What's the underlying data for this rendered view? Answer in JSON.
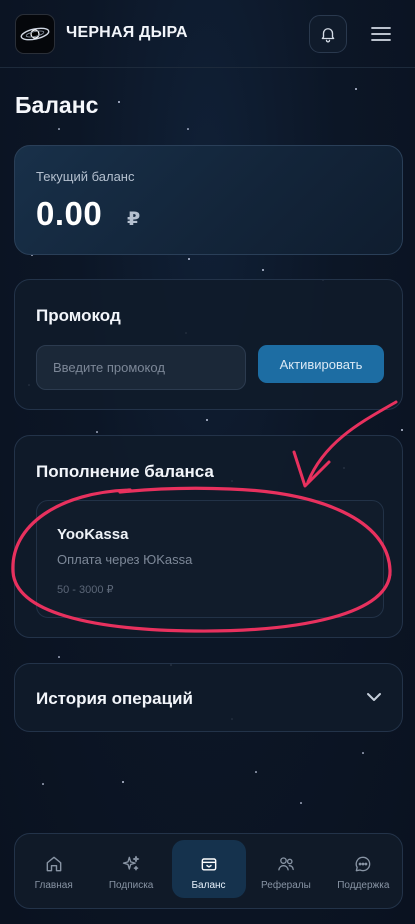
{
  "header": {
    "app_title": "ЧЕРНАЯ ДЫРА",
    "icons": {
      "logo": "black-hole-logo",
      "notifications": "bell-icon",
      "menu": "hamburger-menu-icon"
    }
  },
  "page": {
    "title": "Баланс"
  },
  "balance": {
    "label": "Текущий баланс",
    "amount": "0.00",
    "currency": "₽"
  },
  "promo": {
    "title": "Промокод",
    "input_placeholder": "Введите промокод",
    "input_value": "",
    "activate_label": "Активировать"
  },
  "topup": {
    "title": "Пополнение баланса",
    "method": {
      "name": "YooKassa",
      "description": "Оплата через ЮKassa",
      "range": "50 - 3000 ₽"
    }
  },
  "history": {
    "title": "История операций",
    "icon": "chevron-down-icon"
  },
  "bottom_nav": {
    "items": [
      {
        "label": "Главная",
        "icon": "home-icon",
        "active": false
      },
      {
        "label": "Подписка",
        "icon": "sparkles-icon",
        "active": false
      },
      {
        "label": "Баланс",
        "icon": "wallet-icon",
        "active": true
      },
      {
        "label": "Рефералы",
        "icon": "users-icon",
        "active": false
      },
      {
        "label": "Поддержка",
        "icon": "chat-icon",
        "active": false
      }
    ]
  },
  "colors": {
    "background": "#0b1422",
    "accent": "#1d6da3",
    "annotation": "#e8315e",
    "active_nav": "#15324d"
  }
}
